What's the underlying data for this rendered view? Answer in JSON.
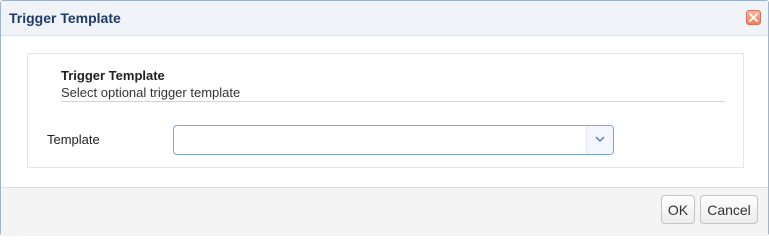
{
  "dialog": {
    "title": "Trigger Template",
    "close_icon": "close-icon"
  },
  "section": {
    "title": "Trigger Template",
    "description": "Select optional trigger template"
  },
  "form": {
    "template_label": "Template",
    "template_value": "",
    "dropdown_icon": "chevron-down-icon"
  },
  "footer": {
    "ok_label": "OK",
    "cancel_label": "Cancel"
  },
  "colors": {
    "title_text": "#1f3a66",
    "close_button": "#ea8265",
    "select_border": "#7fa6d6"
  }
}
